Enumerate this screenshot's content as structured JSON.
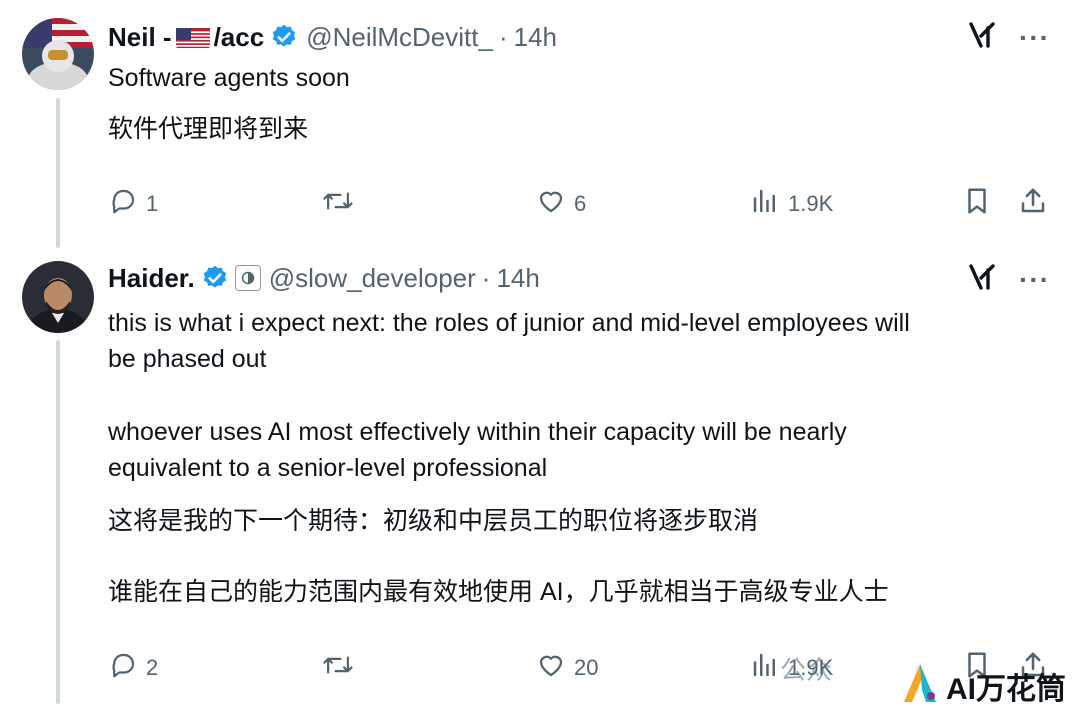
{
  "tweets": [
    {
      "name": "Neil -",
      "name_suffix": "/acc",
      "handle": "@NeilMcDevitt_",
      "time": "14h",
      "lines_en": [
        "Software agents soon"
      ],
      "lines_zh": [
        "软件代理即将到来"
      ],
      "stats": {
        "replies": "1",
        "retweets": "",
        "likes": "6",
        "views": "1.9K"
      }
    },
    {
      "name": "Haider.",
      "handle": "@slow_developer",
      "time": "14h",
      "lines_en": [
        "this is what i expect next: the roles of junior and mid-level employees will",
        "be phased out",
        "whoever uses AI most effectively within their capacity will be nearly",
        "equivalent to a senior-level professional"
      ],
      "lines_zh": [
        "这将是我的下一个期待：初级和中层员工的职位将逐步取消",
        "谁能在自己的能力范围内最有效地使用 AI，几乎就相当于高级专业人士"
      ],
      "stats": {
        "replies": "2",
        "retweets": "",
        "likes": "20",
        "views": "1.9K"
      }
    }
  ],
  "dot": "·",
  "more_glyph": "···",
  "watermark": {
    "brand": "AI万花筒",
    "gray": "公众"
  },
  "colors": {
    "verified": "#1d9bf0",
    "muted": "#536471",
    "text": "#0f1419",
    "thread": "#cfd9de"
  }
}
